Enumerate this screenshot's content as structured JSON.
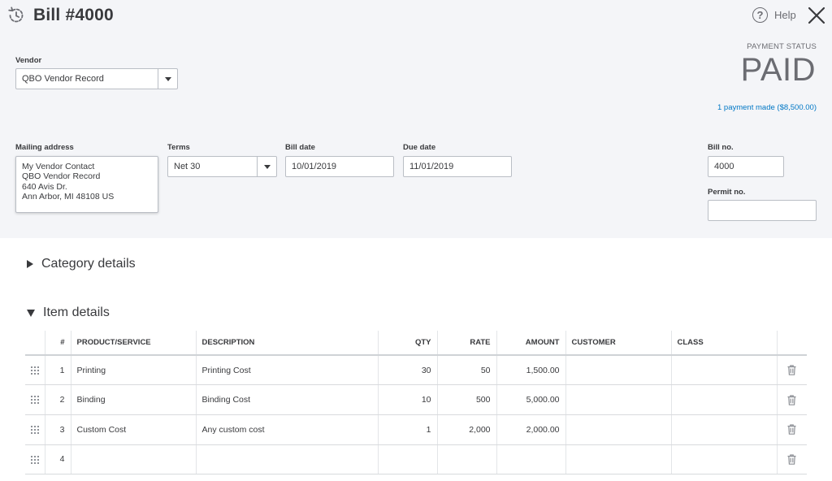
{
  "header": {
    "title": "Bill #4000",
    "help_label": "Help"
  },
  "vendor": {
    "label": "Vendor",
    "value": "QBO Vendor Record"
  },
  "payment_status": {
    "label": "PAYMENT STATUS",
    "value": "PAID",
    "payment_link": "1 payment made ($8,500.00)"
  },
  "mailing_address": {
    "label": "Mailing address",
    "lines": [
      "My Vendor Contact",
      "QBO Vendor Record",
      "640 Avis Dr.",
      "Ann Arbor, MI  48108 US"
    ]
  },
  "terms": {
    "label": "Terms",
    "value": "Net 30"
  },
  "bill_date": {
    "label": "Bill date",
    "value": "10/01/2019"
  },
  "due_date": {
    "label": "Due date",
    "value": "11/01/2019"
  },
  "bill_no": {
    "label": "Bill no.",
    "value": "4000"
  },
  "permit_no": {
    "label": "Permit no.",
    "value": ""
  },
  "sections": {
    "category_details": "Category details",
    "item_details": "Item details"
  },
  "item_table": {
    "columns": [
      "#",
      "PRODUCT/SERVICE",
      "DESCRIPTION",
      "QTY",
      "RATE",
      "AMOUNT",
      "CUSTOMER",
      "CLASS"
    ],
    "rows": [
      {
        "idx": "1",
        "product": "Printing",
        "description": "Printing Cost",
        "qty": "30",
        "rate": "50",
        "amount": "1,500.00",
        "customer": "",
        "class": ""
      },
      {
        "idx": "2",
        "product": "Binding",
        "description": "Binding Cost",
        "qty": "10",
        "rate": "500",
        "amount": "5,000.00",
        "customer": "",
        "class": ""
      },
      {
        "idx": "3",
        "product": "Custom Cost",
        "description": "Any custom cost",
        "qty": "1",
        "rate": "2,000",
        "amount": "2,000.00",
        "customer": "",
        "class": ""
      },
      {
        "idx": "4",
        "product": "",
        "description": "",
        "qty": "",
        "rate": "",
        "amount": "",
        "customer": "",
        "class": ""
      }
    ]
  },
  "icons": {
    "title": "recurring-clock-icon",
    "help": "help-circle-icon",
    "close": "close-x-icon",
    "drag": "drag-handle-icon",
    "delete": "trash-icon"
  },
  "colors": {
    "header_bg": "#f4f5f8",
    "link": "#0077c5",
    "text": "#393a3d"
  }
}
